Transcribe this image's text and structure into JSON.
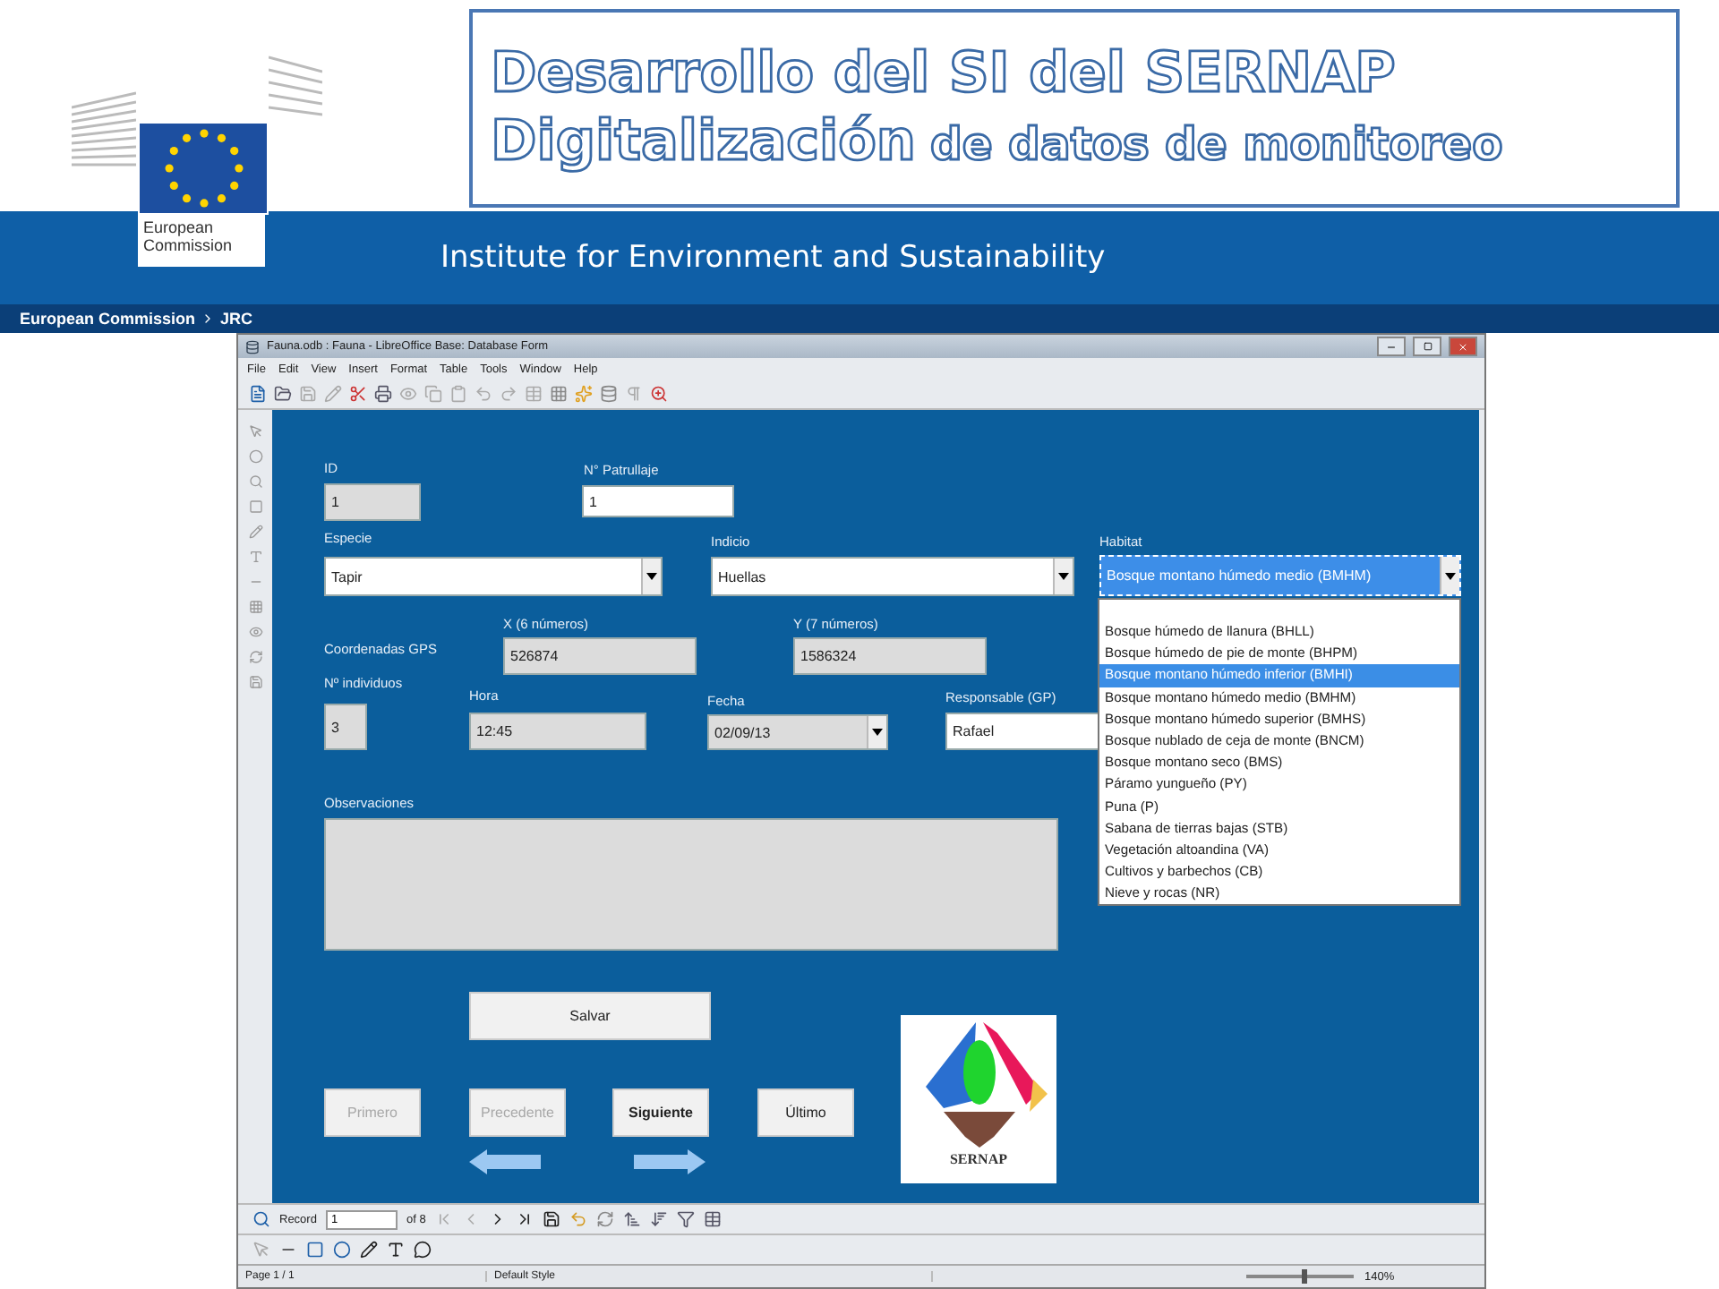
{
  "header": {
    "title_line_1": "Desarrollo del SI del SERNAP",
    "title_line_2_main": "Digitalización",
    "title_line_2_rest": "de datos de monitoreo",
    "logo_caption": "European\nCommission",
    "institute": "Institute for Environment and Sustainability",
    "breadcrumb": [
      "European Commission",
      "JRC"
    ]
  },
  "window": {
    "title": "Fauna.odb : Fauna - LibreOffice Base: Database Form"
  },
  "menu": [
    "File",
    "Edit",
    "View",
    "Insert",
    "Format",
    "Table",
    "Tools",
    "Window",
    "Help"
  ],
  "form": {
    "gps_label": "Coordenadas GPS",
    "fields": [
      {
        "kind": "text",
        "label": "ID",
        "value": "1",
        "readonly": true,
        "focused": false
      },
      {
        "kind": "text",
        "label": "N° Patrullaje",
        "value": "1",
        "readonly": false,
        "focused": false
      },
      {
        "kind": "combo",
        "label": "Especie",
        "value": "Tapir",
        "readonly": false,
        "focused": false
      },
      {
        "kind": "combo",
        "label": "Indicio",
        "value": "Huellas",
        "readonly": false,
        "focused": false
      },
      {
        "kind": "combo",
        "label": "Habitat",
        "value": "Bosque montano húmedo medio (BMHM)",
        "readonly": false,
        "focused": true
      },
      {
        "kind": "text",
        "label": "X (6 números)",
        "value": "526874",
        "readonly": true,
        "focused": false
      },
      {
        "kind": "text",
        "label": "Y (7 números)",
        "value": "1586324",
        "readonly": true,
        "focused": false
      },
      {
        "kind": "text",
        "label": "Nº individuos",
        "value": "3",
        "readonly": true,
        "focused": false
      },
      {
        "kind": "text",
        "label": "Hora",
        "value": "12:45",
        "readonly": true,
        "focused": false
      },
      {
        "kind": "combo",
        "label": "Fecha",
        "value": "02/09/13",
        "readonly": true,
        "focused": false
      },
      {
        "kind": "text",
        "label": "Responsable (GP)",
        "value": "Rafael",
        "readonly": false,
        "focused": false
      },
      {
        "kind": "textarea",
        "label": "Observaciones",
        "readonly": true,
        "focused": false
      }
    ],
    "habitat_options": [
      {
        "label": "Bosque húmedo de llanura (BHLL)",
        "selected": false
      },
      {
        "label": "Bosque húmedo de pie de monte (BHPM)",
        "selected": false
      },
      {
        "label": "Bosque montano húmedo inferior (BMHI)",
        "selected": true
      },
      {
        "label": "Bosque montano húmedo medio (BMHM)",
        "selected": false
      },
      {
        "label": "Bosque montano húmedo superior (BMHS)",
        "selected": false
      },
      {
        "label": "Bosque nublado de ceja de monte (BNCM)",
        "selected": false
      },
      {
        "label": "Bosque montano seco (BMS)",
        "selected": false
      },
      {
        "label": "Páramo yungueño (PY)",
        "selected": false
      },
      {
        "label": "Puna (P)",
        "selected": false
      },
      {
        "label": "Sabana de tierras bajas (STB)",
        "selected": false
      },
      {
        "label": "Vegetación altoandina (VA)",
        "selected": false
      },
      {
        "label": "Cultivos y barbechos (CB)",
        "selected": false
      },
      {
        "label": "Nieve y rocas (NR)",
        "selected": false
      }
    ],
    "save_button": "Salvar",
    "nav_buttons": [
      {
        "label": "Primero",
        "disabled": true
      },
      {
        "label": "Precedente",
        "disabled": true
      },
      {
        "label": "Siguiente",
        "disabled": false
      },
      {
        "label": "Último",
        "disabled": false
      }
    ],
    "logo_text": "SERNAP"
  },
  "record_bar": {
    "label": "Record",
    "value": "1",
    "total": "of 8"
  },
  "status_bar": {
    "page": "Page 1 / 1",
    "style": "Default Style",
    "zoom": "140%",
    "zoom_slider": {
      "level": 0.55
    }
  }
}
